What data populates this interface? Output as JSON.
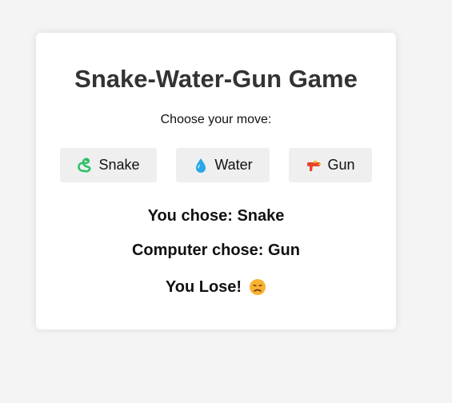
{
  "game": {
    "title": "Snake-Water-Gun Game",
    "prompt": "Choose your move:",
    "buttons": {
      "snake": {
        "label": "Snake",
        "icon": "snake-icon"
      },
      "water": {
        "label": "Water",
        "icon": "droplet-icon"
      },
      "gun": {
        "label": "Gun",
        "icon": "water-gun-icon"
      }
    },
    "result": {
      "user_choice": "You chose: Snake",
      "computer_choice": "Computer chose: Gun",
      "outcome": "You Lose!",
      "outcome_icon": "sad-face-icon"
    }
  }
}
